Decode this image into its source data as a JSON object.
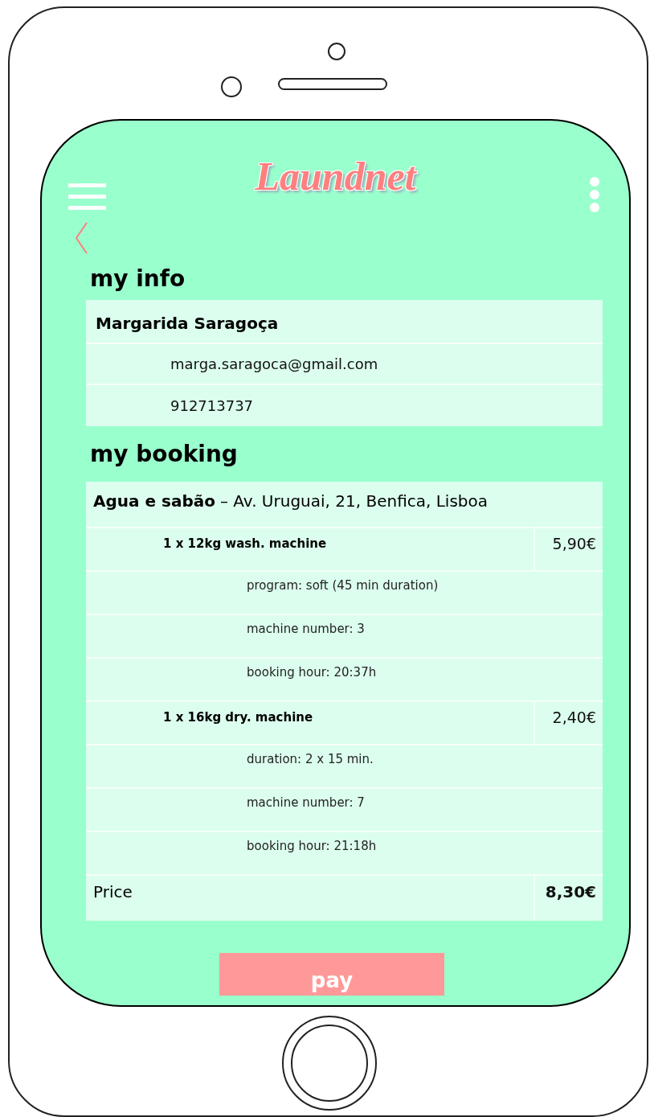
{
  "app": {
    "title": "Laundnet"
  },
  "my_info": {
    "heading": "my info",
    "name": "Margarida Saragoça",
    "email": "marga.saragoca@gmail.com",
    "phone": "912713737"
  },
  "my_booking": {
    "heading": "my booking",
    "store": "Agua e sabão",
    "address": "– Av. Uruguai, 21, Benfica, Lisboa",
    "items": [
      {
        "name": "1 x 12kg wash. machine",
        "price": "5,90€",
        "details": [
          "program: soft (45 min duration)",
          "machine number: 3",
          "booking hour: 20:37h"
        ]
      },
      {
        "name": "1 x 16kg dry. machine",
        "price": "2,40€",
        "details": [
          "duration: 2 x 15 min.",
          "machine number: 7",
          "booking hour: 21:18h"
        ]
      }
    ],
    "total_label": "Price",
    "total": "8,30€"
  },
  "pay_button": "pay"
}
